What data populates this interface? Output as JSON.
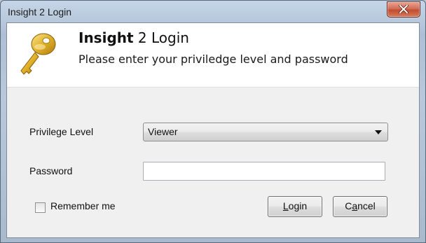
{
  "window": {
    "title": "Insight 2 Login"
  },
  "header": {
    "title_bold": "Insight",
    "title_rest": " 2 Login",
    "subtitle": "Please enter your priviledge level and password"
  },
  "form": {
    "privilege_label": "Privilege Level",
    "privilege_value": "Viewer",
    "password_label": "Password",
    "password_value": "",
    "remember_label": "Remember me",
    "remember_checked": false
  },
  "buttons": {
    "login_mnemonic": "L",
    "login_rest": "ogin",
    "cancel_pre": "C",
    "cancel_mnemonic": "a",
    "cancel_rest": "ncel"
  },
  "icons": {
    "close": "close-icon",
    "key": "key-icon",
    "dropdown": "chevron-down-icon"
  },
  "colors": {
    "close_button": "#c24b31",
    "key_gold": "#e0b02a"
  }
}
